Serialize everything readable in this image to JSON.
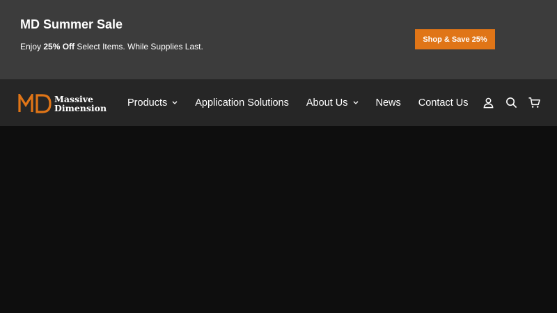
{
  "promo": {
    "title": "MD Summer Sale",
    "sub_prefix": "Enjoy ",
    "sub_bold": "25% Off",
    "sub_suffix": " Select Items. While Supplies Last.",
    "button_label": "Shop & Save 25%"
  },
  "logo": {
    "line1": "Massive",
    "line2": "Dimension",
    "mark": "MD"
  },
  "nav": {
    "items": [
      {
        "label": "Products",
        "has_dropdown": true
      },
      {
        "label": "Application Solutions",
        "has_dropdown": false
      },
      {
        "label": "About Us",
        "has_dropdown": true
      },
      {
        "label": "News",
        "has_dropdown": false
      },
      {
        "label": "Contact Us",
        "has_dropdown": false
      }
    ],
    "icons": [
      "user-icon",
      "search-icon",
      "cart-icon"
    ]
  },
  "colors": {
    "promo_bg": "#3c3c3c",
    "nav_bg": "#262626",
    "accent": "#e07517",
    "hero_bg": "#0e0e0e"
  }
}
